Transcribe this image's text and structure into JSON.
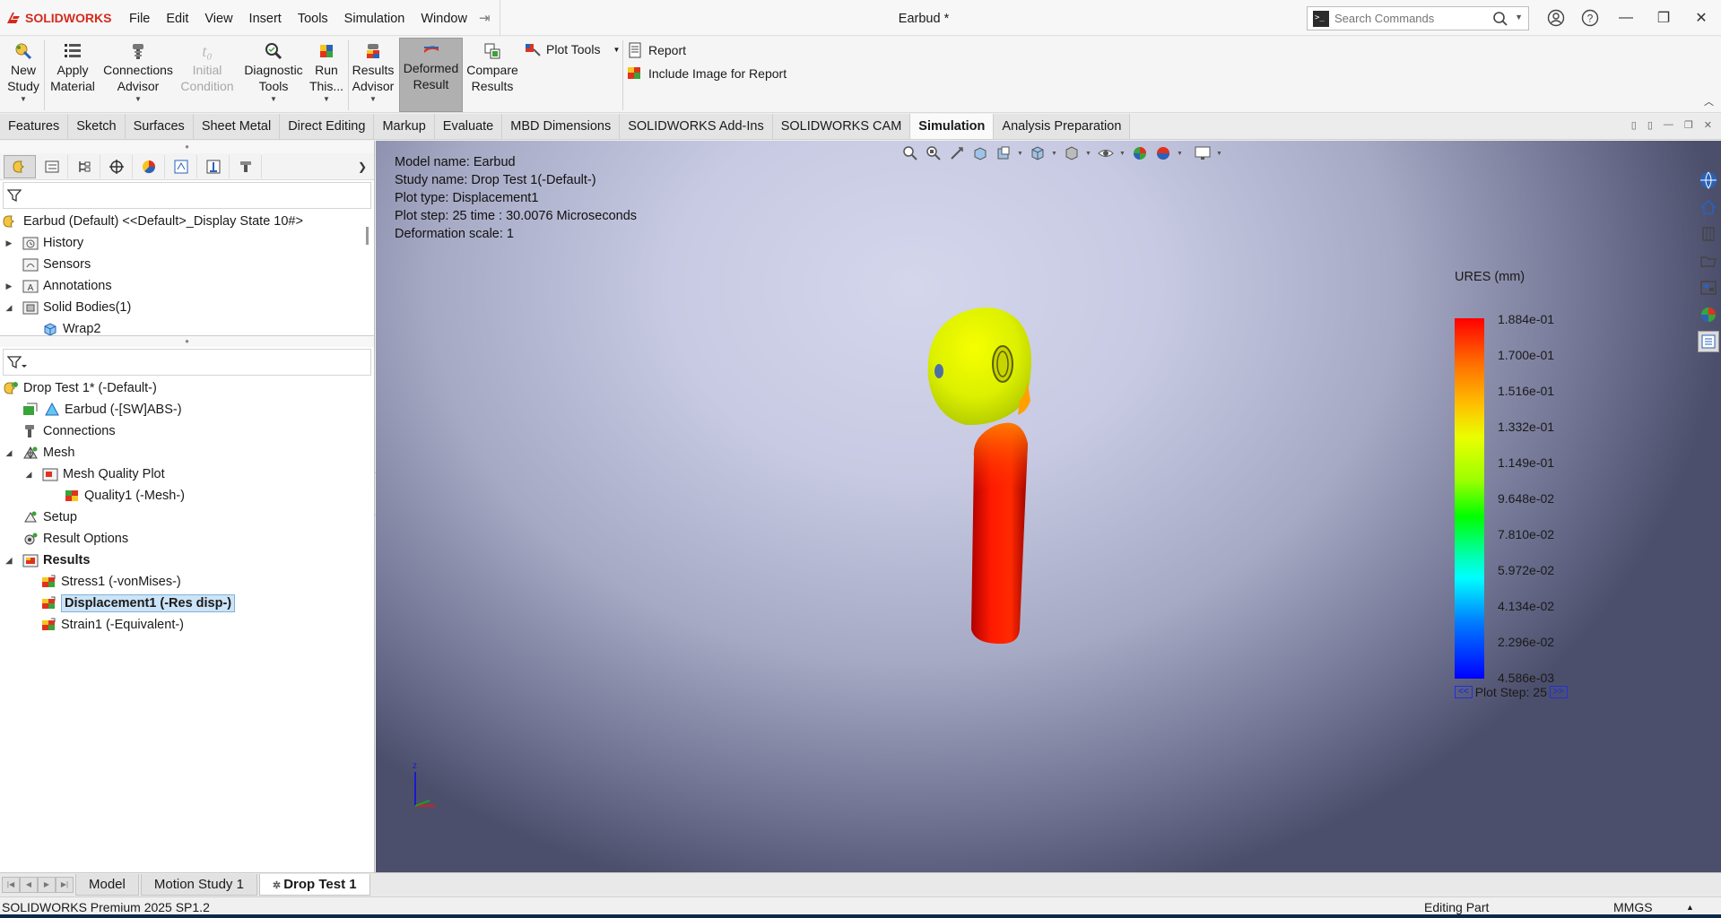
{
  "app": {
    "brand": "SOLIDWORKS",
    "document_title": "Earbud *",
    "menu": [
      "File",
      "Edit",
      "View",
      "Insert",
      "Tools",
      "Simulation",
      "Window"
    ],
    "search_placeholder": "Search Commands"
  },
  "ribbon": {
    "new_study": [
      "New",
      "Study"
    ],
    "apply_material": [
      "Apply",
      "Material"
    ],
    "connections_advisor": [
      "Connections",
      "Advisor"
    ],
    "initial_condition": [
      "Initial",
      "Condition"
    ],
    "diagnostic_tools": [
      "Diagnostic",
      "Tools"
    ],
    "run_this": [
      "Run",
      "This..."
    ],
    "results_advisor": [
      "Results",
      "Advisor"
    ],
    "deformed_result": [
      "Deformed",
      "Result"
    ],
    "compare_results": [
      "Compare",
      "Results"
    ],
    "plot_tools": "Plot Tools",
    "report": "Report",
    "include_image": "Include Image for Report"
  },
  "tabs": [
    "Features",
    "Sketch",
    "Surfaces",
    "Sheet Metal",
    "Direct Editing",
    "Markup",
    "Evaluate",
    "MBD Dimensions",
    "SOLIDWORKS Add-Ins",
    "SOLIDWORKS CAM",
    "Simulation",
    "Analysis Preparation"
  ],
  "active_tab": "Simulation",
  "feature_tree": {
    "root": "Earbud (Default) <<Default>_Display State 10#>",
    "history": "History",
    "sensors": "Sensors",
    "annotations": "Annotations",
    "solid_bodies": "Solid Bodies(1)",
    "wrap2": "Wrap2"
  },
  "study_tree": {
    "study": "Drop Test 1* (-Default-)",
    "part": "Earbud (-[SW]ABS-)",
    "connections": "Connections",
    "mesh": "Mesh",
    "mesh_quality_plot": "Mesh Quality Plot",
    "quality1": "Quality1 (-Mesh-)",
    "setup": "Setup",
    "result_options": "Result Options",
    "results": "Results",
    "stress1": "Stress1 (-vonMises-)",
    "displacement1": "Displacement1 (-Res disp-)",
    "strain1": "Strain1 (-Equivalent-)"
  },
  "viewport": {
    "model_name": "Model name: Earbud",
    "study_name": "Study name: Drop Test 1(-Default-)",
    "plot_type": "Plot type:  Displacement1",
    "plot_step": "Plot step: 25    time : 30.0076 Microseconds",
    "deformation_scale": "Deformation scale: 1",
    "legend_title": "URES (mm)",
    "legend_values": [
      "1.884e-01",
      "1.700e-01",
      "1.516e-01",
      "1.332e-01",
      "1.149e-01",
      "9.648e-02",
      "7.810e-02",
      "5.972e-02",
      "4.134e-02",
      "2.296e-02",
      "4.586e-03"
    ],
    "step_prev": "<<",
    "step_label": "Plot Step: 25",
    "step_next": ">>",
    "triad_z": "z"
  },
  "bottom_tabs": [
    "Model",
    "Motion Study 1",
    "Drop Test 1"
  ],
  "active_bottom_tab": "Drop Test 1",
  "status": {
    "product": "SOLIDWORKS Premium 2025 SP1.2",
    "mode": "Editing Part",
    "units": "MMGS"
  },
  "colors": {
    "brand_red": "#d52b1e",
    "selection_blue": "#cce4f7"
  }
}
